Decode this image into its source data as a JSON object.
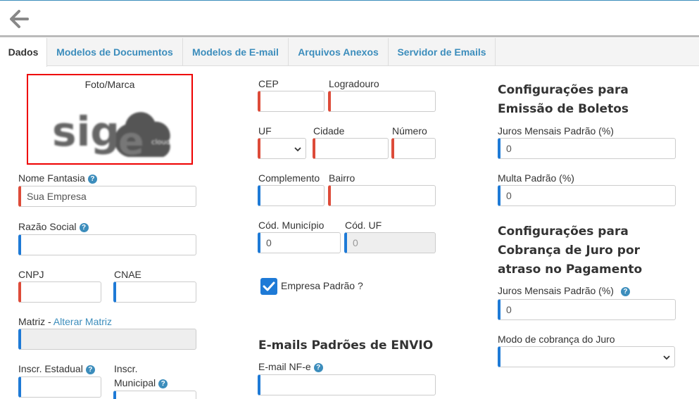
{
  "tabs": [
    {
      "label": "Dados"
    },
    {
      "label": "Modelos de Documentos"
    },
    {
      "label": "Modelos de E-mail"
    },
    {
      "label": "Arquivos Anexos"
    },
    {
      "label": "Servidor de Emails"
    }
  ],
  "photo": {
    "label": "Foto/Marca",
    "logo_text": "sig",
    "logo_e": "e",
    "logo_badge": "cloud"
  },
  "col1": {
    "nome_fantasia_label": "Nome Fantasia",
    "nome_fantasia_value": "Sua Empresa",
    "razao_social_label": "Razão Social",
    "razao_social_value": "",
    "cnpj_label": "CNPJ",
    "cnae_label": "CNAE",
    "matriz_label": "Matriz - ",
    "matriz_link": "Alterar Matriz",
    "inscr_estadual_label": "Inscr. Estadual",
    "inscr_municipal_label_1": "Inscr.",
    "inscr_municipal_label_2": "Municipal"
  },
  "col2": {
    "cep_label": "CEP",
    "logradouro_label": "Logradouro",
    "uf_label": "UF",
    "cidade_label": "Cidade",
    "numero_label": "Número",
    "complemento_label": "Complemento",
    "bairro_label": "Bairro",
    "cod_municipio_label": "Cód. Município",
    "cod_municipio_value": "0",
    "cod_uf_label": "Cód. UF",
    "cod_uf_value": "0",
    "empresa_padrao_label": "Empresa Padrão ?",
    "empresa_padrao_checked": true,
    "emails_title": "E-mails Padrões de ENVIO",
    "email_nfe_label": "E-mail NF-e"
  },
  "col3": {
    "boletos_title_1": "Configurações para",
    "boletos_title_2": "Emissão de Boletos",
    "juros_mensais_label": "Juros Mensais Padrão (%)",
    "juros_mensais_value": "0",
    "multa_label": "Multa Padrão (%)",
    "multa_value": "0",
    "cobranca_title_1": "Configurações para",
    "cobranca_title_2": "Cobrança de Juro por",
    "cobranca_title_3": "atraso no Pagamento",
    "juros_mensais2_label": "Juros Mensais Padrão (%)",
    "juros_mensais2_value": "0",
    "modo_cobranca_label": "Modo de cobrança do Juro",
    "modo_cobranca_value": ""
  },
  "help_glyph": "?",
  "colors": {
    "accent": "#3c8dbc",
    "required": "#dd4b39",
    "optional": "#1e7ad6",
    "photo_border": "#e00000"
  }
}
